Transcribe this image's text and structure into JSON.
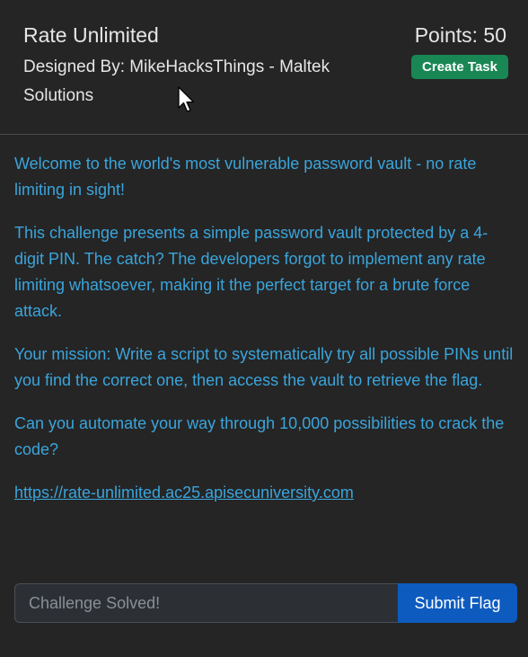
{
  "header": {
    "title": "Rate Unlimited",
    "designer": "Designed By: MikeHacksThings - Maltek Solutions",
    "points": "Points: 50",
    "create_task_label": "Create Task"
  },
  "description": {
    "paragraphs": [
      "Welcome to the world's most vulnerable password vault - no rate limiting in sight!",
      "This challenge presents a simple password vault protected by a 4-digit PIN. The catch? The developers forgot to implement any rate limiting whatsoever, making it the perfect target for a brute force attack.",
      "Your mission: Write a script to systematically try all possible PINs until you find the correct one, then access the vault to retrieve the flag.",
      "Can you automate your way through 10,000 possibilities to crack the code?"
    ],
    "link_text": "https://rate-unlimited.ac25.apisecuniversity.com"
  },
  "flag_form": {
    "placeholder": "Challenge Solved!",
    "value": "",
    "submit_label": "Submit Flag"
  },
  "colors": {
    "background": "#252525",
    "text": "#e6e6e6",
    "description_text": "#3aa5dc",
    "create_task_bg": "#198754",
    "submit_bg": "#0d5bbf"
  }
}
